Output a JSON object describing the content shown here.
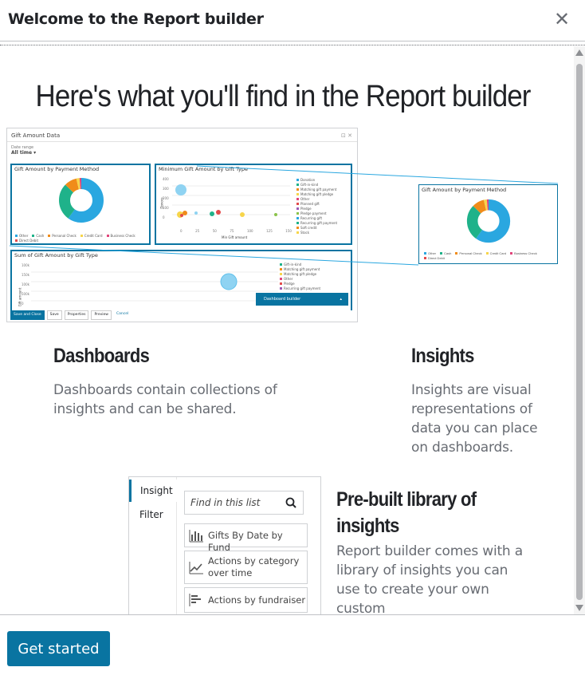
{
  "modal": {
    "title": "Welcome to the Report builder",
    "close_glyph": "✕"
  },
  "headline": "Here's what you'll find in the Report builder",
  "preview": {
    "window_title": "Gift Amount Data",
    "date_range_label": "Date range",
    "date_range_value": "All time",
    "panel1_title": "Gift Amount by Payment Method",
    "panel2_title": "Minimum Gift Amount by Gift Type",
    "panel3_title": "Sum of Gift Amount by Gift Type",
    "floating_title": "Gift Amount by Payment Method",
    "panel2_xlabel": "Min Gift amount",
    "panel2_ylabel": "Donors",
    "panel3_ylabel": "Gift amount",
    "panel2_xticks": [
      "0",
      "25",
      "50",
      "75",
      "100",
      "125",
      "150"
    ],
    "panel2_yticks": [
      "400",
      "300",
      "200",
      "100",
      "0"
    ],
    "panel3_yticks": [
      "100k",
      "150k",
      "100k",
      "500k",
      "0"
    ],
    "donut_legend": [
      "Other",
      "Cash",
      "Personal Check",
      "Credit Card",
      "Business Check",
      "Direct Debit"
    ],
    "donut_legend_colors": [
      "#2aa7e0",
      "#1fb28a",
      "#f08c1a",
      "#f7d54a",
      "#e0457b",
      "#e34a4a"
    ],
    "scatter_legend": [
      "Donation",
      "Gift-in-kind",
      "Matching gift payment",
      "Matching gift pledge",
      "Other",
      "Planned gift",
      "Pledge",
      "Pledge payment",
      "Recurring gift",
      "Recurring gift payment",
      "Soft credit",
      "Stock"
    ],
    "scatter_legend_colors": [
      "#2aa7e0",
      "#1fb28a",
      "#f08c1a",
      "#f7d54a",
      "#e0457b",
      "#e34a4a",
      "#9b59b6",
      "#8bc34a",
      "#2aa7e0",
      "#1fb28a",
      "#f08c1a",
      "#f7d54a"
    ],
    "sum_legend": [
      "Gift-in-kind",
      "Matching gift payment",
      "Matching gift pledge",
      "Other",
      "Pledge",
      "Recurring gift payment"
    ],
    "sum_legend_colors": [
      "#1fb28a",
      "#f08c1a",
      "#f7d54a",
      "#e0457b",
      "#e34a4a",
      "#9b59b6"
    ],
    "dashboard_builder_label": "Dashboard builder",
    "buttons": {
      "save_close": "Save and Close",
      "save": "Save",
      "properties": "Properties",
      "preview": "Preview",
      "cancel": "Cancel"
    }
  },
  "sections": {
    "dashboards": {
      "title": "Dashboards",
      "text": "Dashboards contain collections of insights and can be shared."
    },
    "insights": {
      "title": "Insights",
      "text": "Insights are visual representations of data you can place on dashboards."
    },
    "library": {
      "title": "Pre-built library of insights",
      "text": "Report builder comes with a library of insights you can use to create your own custom"
    }
  },
  "library_preview": {
    "tabs": [
      "Insight",
      "Filter"
    ],
    "search_placeholder": "Find in this list",
    "items": [
      {
        "label": "Gifts By Date by Fund",
        "icon": "bar-chart-icon"
      },
      {
        "label": "Actions by category over time",
        "icon": "line-chart-icon"
      },
      {
        "label": "Actions by fundraiser",
        "icon": "horizontal-bar-icon"
      }
    ]
  },
  "footer": {
    "primary_label": "Get started"
  },
  "colors": {
    "accent": "#0974a1",
    "muted_text": "#686c73"
  }
}
